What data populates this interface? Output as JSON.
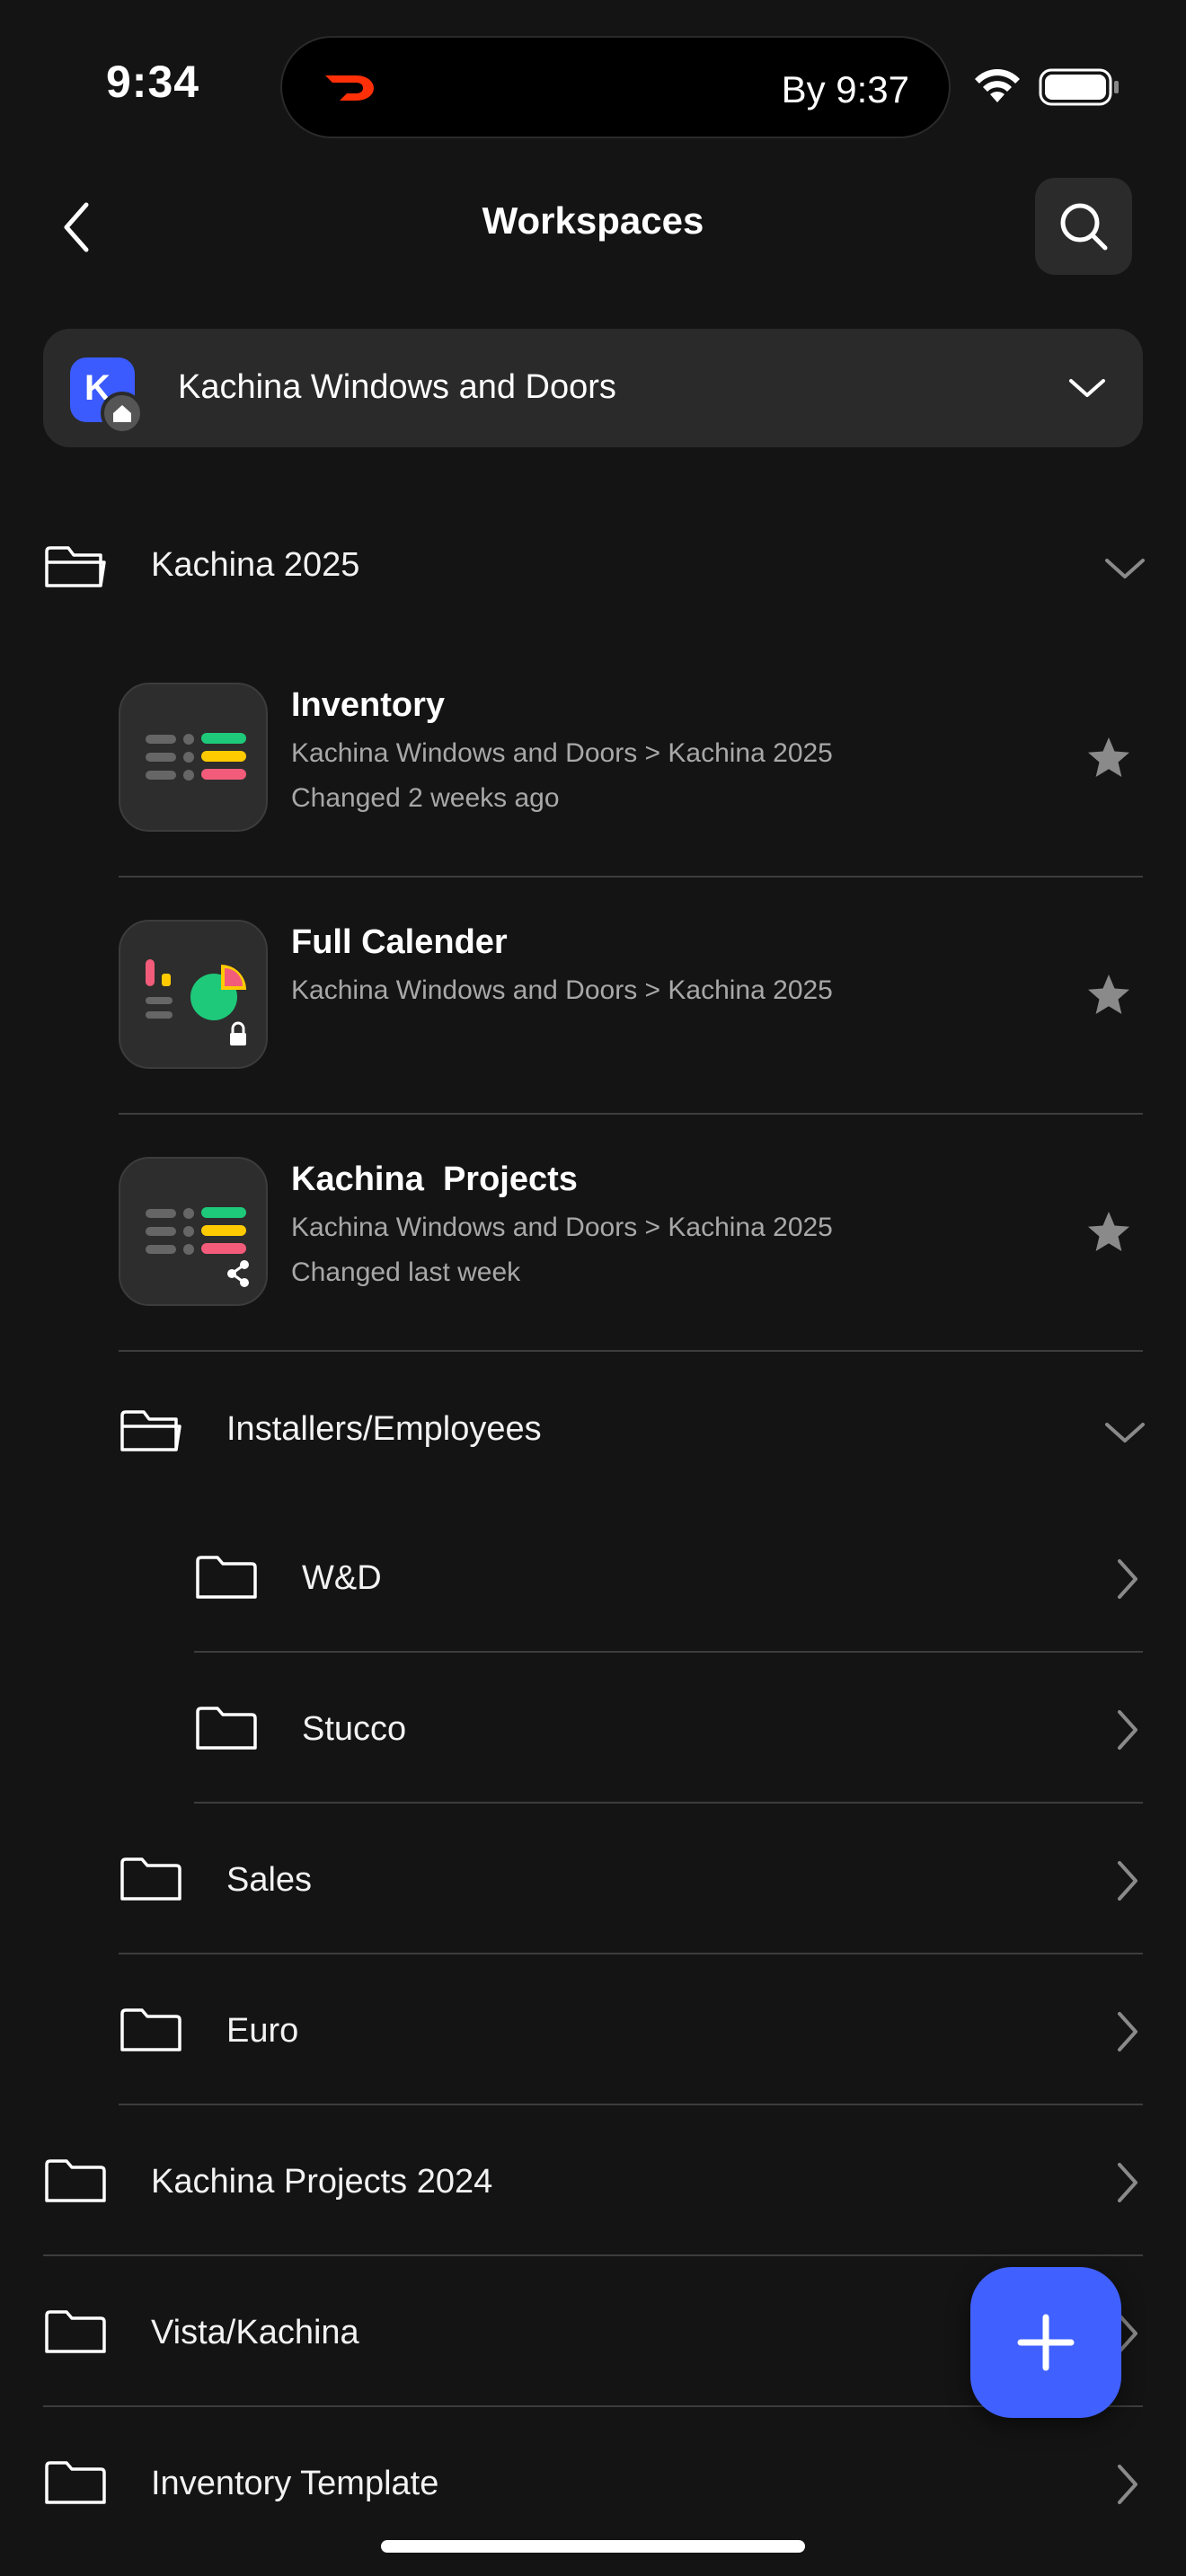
{
  "status_bar": {
    "time": "9:34",
    "eta": "By 9:37"
  },
  "header": {
    "title": "Workspaces"
  },
  "workspace": {
    "avatar_letter": "K",
    "name": "Kachina Windows and Doors"
  },
  "folders": {
    "kachina_2025": "Kachina 2025",
    "installers": "Installers/Employees",
    "wd": "W&D",
    "stucco": "Stucco",
    "sales": "Sales",
    "euro": "Euro",
    "projects_2024": "Kachina Projects 2024",
    "vista": "Vista/Kachina",
    "inventory_template": "Inventory Template"
  },
  "boards": [
    {
      "title": "Inventory",
      "path": "Kachina Windows and Doors > Kachina 2025",
      "changed": "Changed 2 weeks ago"
    },
    {
      "title": "Full Calender",
      "path": "Kachina Windows and Doors > Kachina 2025",
      "changed": ""
    },
    {
      "title": "Kachina  Projects",
      "path": "Kachina Windows and Doors > Kachina 2025",
      "changed": "Changed last week"
    }
  ],
  "colors": {
    "accent": "#4060ff",
    "background": "#141414",
    "green": "#1ec97a",
    "yellow": "#ffcb00",
    "red": "#f25c7a"
  },
  "icons": [
    "back-icon",
    "search-icon",
    "chevron-down-icon",
    "folder-open-icon",
    "folder-icon",
    "chevron-right-icon",
    "star-icon",
    "lock-icon",
    "share-icon",
    "plus-icon"
  ]
}
